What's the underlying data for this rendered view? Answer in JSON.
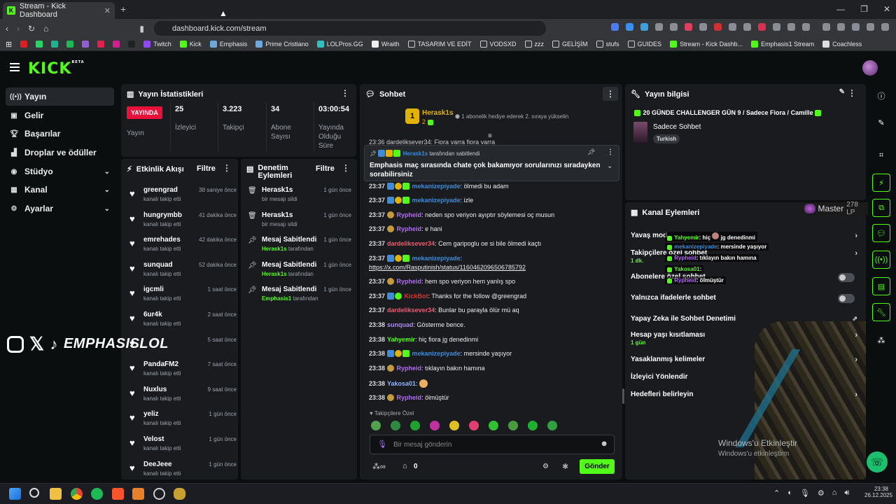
{
  "browser": {
    "tab_title": "Stream - Kick Dashboard",
    "url": "dashboard.kick.com/stream",
    "bookmarks": [
      "Twitch",
      "Kick",
      "Emphasis",
      "Prime Cristiano",
      "LOLPros.GG",
      "Wraith",
      "TASARIM VE EDİT",
      "VODSXD",
      "zzz",
      "GELİŞİM",
      "stufs",
      "GUIDES",
      "Stream - Kick Dashb...",
      "Emphasis1 Stream",
      "Coachless"
    ]
  },
  "kick": {
    "logo": "KICK",
    "beta": "BETA"
  },
  "sidebar": {
    "items": [
      {
        "label": "Yayın",
        "icon": "broadcast-icon"
      },
      {
        "label": "Gelir",
        "icon": "wallet-icon"
      },
      {
        "label": "Başarılar",
        "icon": "trophy-icon"
      },
      {
        "label": "Droplar ve ödüller",
        "icon": "gift-icon"
      },
      {
        "label": "Stüdyo",
        "icon": "studio-icon"
      },
      {
        "label": "Kanal",
        "icon": "channel-icon"
      },
      {
        "label": "Ayarlar",
        "icon": "gear-icon"
      }
    ]
  },
  "stats": {
    "title": "Yayın İstatistikleri",
    "live_label": "YAYINDA",
    "live_sub": "Yayın",
    "items": [
      {
        "value": "25",
        "label": "İzleyici"
      },
      {
        "value": "3.223",
        "label": "Takipçi"
      },
      {
        "value": "34",
        "label": "Abone Sayısı"
      },
      {
        "value": "03:00:54",
        "label": "Yayında Olduğu Süre"
      }
    ]
  },
  "activity": {
    "title": "Etkinlik Akışı",
    "filter": "Filtre",
    "items": [
      {
        "name": "greengrad",
        "sub": "kanalı takip etti",
        "time": "38 saniye önce"
      },
      {
        "name": "hungrymbb",
        "sub": "kanalı takip etti",
        "time": "41 dakika önce"
      },
      {
        "name": "emrehades",
        "sub": "kanalı takip etti",
        "time": "42 dakika önce"
      },
      {
        "name": "sunquad",
        "sub": "kanalı takip etti",
        "time": "52 dakika önce"
      },
      {
        "name": "igcmli",
        "sub": "kanalı takip etti",
        "time": "1 saat önce"
      },
      {
        "name": "6ur4k",
        "sub": "kanalı takip etti",
        "time": "2 saat önce"
      },
      {
        "name": "",
        "sub": "",
        "time": "5 saat önce"
      },
      {
        "name": "PandaFM2",
        "sub": "kanalı takip etti",
        "time": "7 saat önce"
      },
      {
        "name": "Nuxlus",
        "sub": "kanalı takip etti",
        "time": "9 saat önce"
      },
      {
        "name": "yeliz",
        "sub": "kanalı takip etti",
        "time": "1 gün önce"
      },
      {
        "name": "Velost",
        "sub": "kanalı takip etti",
        "time": "1 gün önce"
      },
      {
        "name": "DeeJeee",
        "sub": "kanalı takip etti",
        "time": "1 gün önce"
      }
    ]
  },
  "moderation": {
    "title": "Denetim Eylemleri",
    "filter": "Filtre",
    "items": [
      {
        "name": "Herask1s",
        "sub_pre": "",
        "sub_user": "",
        "sub": "bir mesajı sildi",
        "time": "1 gün önce",
        "icon": "trash-icon"
      },
      {
        "name": "Herask1s",
        "sub_pre": "",
        "sub_user": "",
        "sub": "bir mesajı sildi",
        "time": "1 gün önce",
        "icon": "trash-icon"
      },
      {
        "name": "Mesaj Sabitlendi",
        "sub_user": "Herask1s",
        "sub": "tarafından",
        "time": "1 gün önce",
        "icon": "pin-icon"
      },
      {
        "name": "Mesaj Sabitlendi",
        "sub_user": "Herask1s",
        "sub": "tarafından",
        "time": "1 gün önce",
        "icon": "pin-icon"
      },
      {
        "name": "Mesaj Sabitlendi",
        "sub_user": "Emphasis1",
        "sub": "tarafından",
        "time": "1 gün önce",
        "icon": "pin-icon"
      }
    ]
  },
  "chat": {
    "title": "Sohbet",
    "gifter_name": "Herask1s",
    "gifter_count": "2",
    "gift_text": "1 abonelik hediye ederek 2. sıraya yükselin",
    "cut_line": "23:36 dardeliksever34: Fiora varra fiora varra",
    "pinned_by_user": "Herask1s",
    "pinned_by_text": "tarafından sabitlendi",
    "pinned_text": "Emphasis maç sırasında chate çok bakamıyor sorularınızı sıradayken sorabilirsiniz",
    "messages": [
      {
        "time": "23:37",
        "user": "mekanizepiyade",
        "color": "#3e8bd8",
        "text": ": ölmedi bu adam"
      },
      {
        "time": "23:37",
        "user": "mekanizepiyade",
        "color": "#3e8bd8",
        "text": ": izle"
      },
      {
        "time": "23:37",
        "user": "Rypheid",
        "color": "#b06cf0",
        "text": ": neden spo veriyon ayıptır söylemesi oç musun"
      },
      {
        "time": "23:37",
        "user": "Rypheid",
        "color": "#b06cf0",
        "text": ": e hani"
      },
      {
        "time": "23:37",
        "user": "dardeliksever34",
        "color": "#f05a6e",
        "text": ": Cem garipoglu oe si bile ölmedi kaçtı"
      },
      {
        "time": "23:37",
        "user": "mekanizepiyade",
        "color": "#3e8bd8",
        "text": ":"
      },
      {
        "time": "",
        "user": "",
        "color": "#eee",
        "text": "https://x.com/Rasputinish/status/1160462096506785792"
      },
      {
        "time": "23:37",
        "user": "Rypheid",
        "color": "#b06cf0",
        "text": ": hem spo veriyon hem yanlış spo"
      },
      {
        "time": "23:37",
        "user": "KickBot",
        "color": "#e0312b",
        "text": ": Thanks for the follow @greengrad"
      },
      {
        "time": "23:37",
        "user": "dardeliksever34",
        "color": "#f05a6e",
        "text": ": Bunlar bu parayla ölür mü aq"
      },
      {
        "time": "23:38",
        "user": "sunquad",
        "color": "#a98bf0",
        "text": ": Gösterme bence."
      },
      {
        "time": "23:38",
        "user": "Yahyemir",
        "color": "#53fc18",
        "text": ": hiç fiora jg denedinmi"
      },
      {
        "time": "23:38",
        "user": "mekanizepiyade",
        "color": "#3e8bd8",
        "text": ": mersinde yaşıyor"
      },
      {
        "time": "23:38",
        "user": "Rypheid",
        "color": "#b06cf0",
        "text": ": tıklayın bakın hamına"
      },
      {
        "time": "23:38",
        "user": "Yakosa01",
        "color": "#8fb4ff",
        "text": ":"
      },
      {
        "time": "23:38",
        "user": "Rypheid",
        "color": "#b06cf0",
        "text": ": ölmüştür"
      }
    ],
    "followers_only": "Takipçilere Özel",
    "input_placeholder": "Bir mesaj gönderin",
    "points": "0",
    "send": "Gönder"
  },
  "stream_info": {
    "title": "Yayın bilgisi",
    "stream_title": "20 GÜNDE CHALLENGER GÜN 9 / Sadece Fiora / Camille",
    "category": "Sadece Sohbet",
    "language": "Turkish"
  },
  "channel_actions": {
    "title": "Kanal Eylemleri",
    "rank_label": "Master",
    "rank_lp": "278 LP",
    "rows": [
      {
        "label": "Yavaş mod",
        "sub": "",
        "type": "chev"
      },
      {
        "label": "Takipçilere özel sohbet",
        "sub": "1 dk.",
        "type": "chev"
      },
      {
        "label": "Abonelere özel sohbet",
        "sub": "",
        "type": "toggle"
      },
      {
        "label": "Yalnızca ifadelerle sohbet",
        "sub": "",
        "type": "toggle"
      },
      {
        "label": "Yapay Zeka ile Sohbet Denetimi",
        "sub": "",
        "type": "ext"
      },
      {
        "label": "Hesap yaşı kısıtlaması",
        "sub": "1 gün",
        "type": "chev"
      },
      {
        "label": "Yasaklanmış kelimeler",
        "sub": "",
        "type": "chev"
      },
      {
        "label": "İzleyici Yönlendir",
        "sub": "",
        "type": "none"
      },
      {
        "label": "Hedefleri belirleyin",
        "sub": "",
        "type": "chev"
      }
    ],
    "overlay_chat": [
      {
        "user": "Yahyemir",
        "text": ": hiç",
        "text2": "jg denedinmi"
      },
      {
        "user": "mekanizepiyade",
        "text": ": mersinde yaşıyor",
        "text2": ""
      },
      {
        "user": "Rypheid",
        "text": ": tıklayın bakın hamına",
        "text2": ""
      },
      {
        "user": "Yakosa01",
        "text": ":",
        "text2": ""
      },
      {
        "user": "Rypheid",
        "text": ": ölmüştür",
        "text2": ""
      }
    ]
  },
  "overlay": {
    "social_handle": "EMPHASISLOL",
    "windows_1": "Windows'u Etkinleştir",
    "windows_2": "Windows'u etkinleştirm"
  },
  "taskbar": {
    "time": "23:38",
    "date": "26.12.2025"
  },
  "colors": {
    "brand": "#53fc18",
    "live": "#e9113c",
    "panel": "#191b1f"
  }
}
